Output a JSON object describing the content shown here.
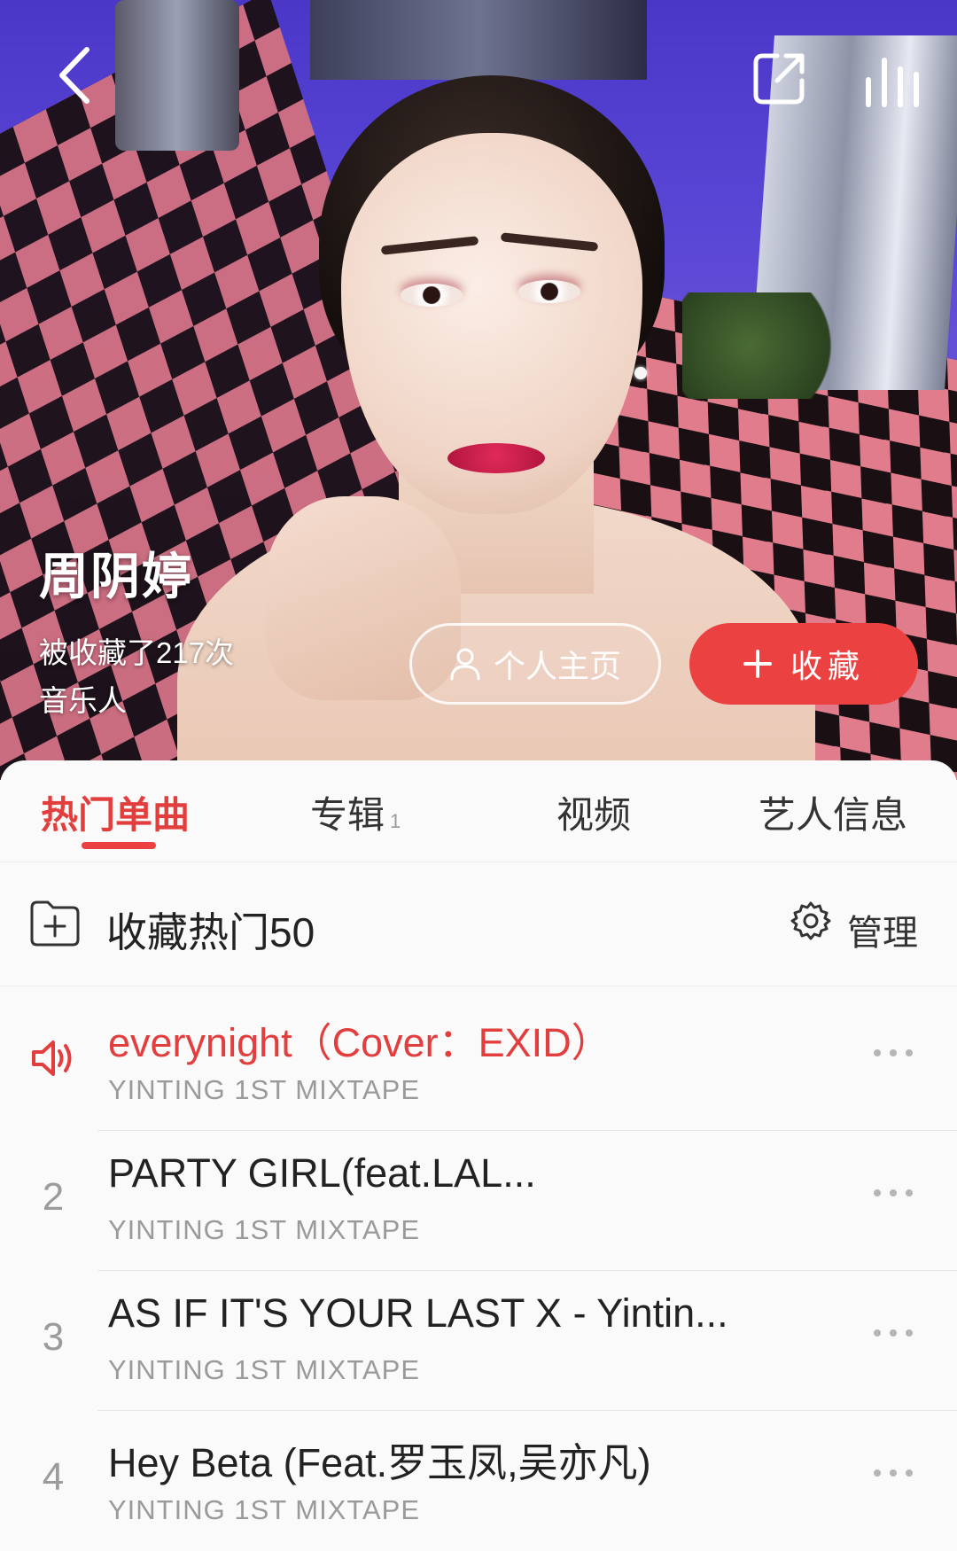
{
  "header": {
    "artist_name": "周阴婷",
    "favorited_text": "被收藏了217次",
    "artist_type": "音乐人",
    "profile_button_label": "个人主页",
    "collect_button_label": "收藏"
  },
  "tabs": [
    {
      "label": "热门单曲",
      "count": "",
      "active": true
    },
    {
      "label": "专辑",
      "count": "1",
      "active": false
    },
    {
      "label": "视频",
      "count": "",
      "active": false
    },
    {
      "label": "艺人信息",
      "count": "",
      "active": false
    }
  ],
  "actions": {
    "collect_hot_label": "收藏热门50",
    "manage_label": "管理"
  },
  "songs": [
    {
      "rank": "",
      "playing": true,
      "title": "everynight（Cover：EXID）",
      "album": "YINTING 1ST MIXTAPE"
    },
    {
      "rank": "2",
      "playing": false,
      "title": "PARTY GIRL(feat.LAL...",
      "album": "YINTING 1ST MIXTAPE"
    },
    {
      "rank": "3",
      "playing": false,
      "title": "AS IF IT'S YOUR LAST X - Yintin...",
      "album": "YINTING 1ST MIXTAPE"
    },
    {
      "rank": "4",
      "playing": false,
      "title": "Hey Beta (Feat.罗玉凤,吴亦凡)",
      "album": "YINTING 1ST MIXTAPE"
    }
  ],
  "icons": {
    "back": "chevron-left-icon",
    "share": "share-icon",
    "now_playing": "equalizer-bars-icon",
    "profile": "user-icon",
    "collect": "plus-icon",
    "add_folder": "add-folder-icon",
    "manage": "gear-icon",
    "playing": "speaker-icon",
    "more": "more-dots-icon"
  },
  "colors": {
    "accent": "#ec4141",
    "active_text": "#e33e3e"
  }
}
